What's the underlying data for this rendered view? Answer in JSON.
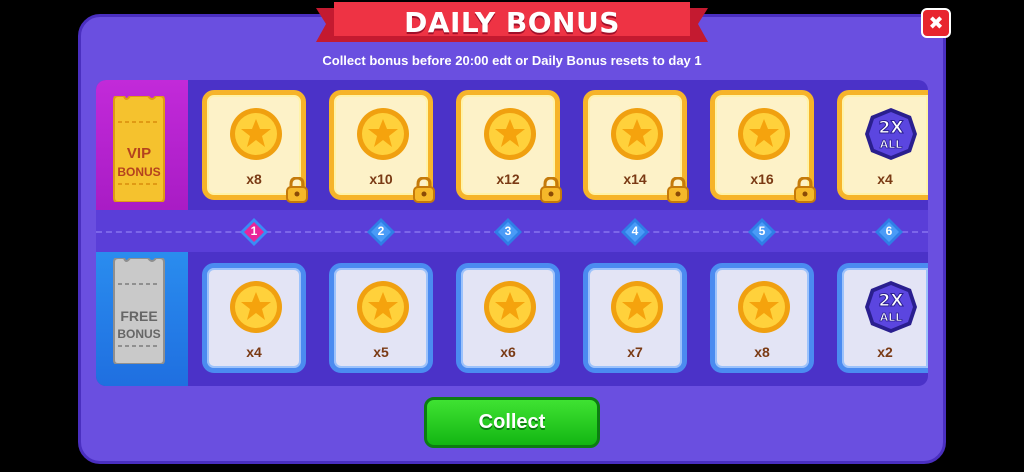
{
  "header": {
    "title": "DAILY BONUS",
    "subtitle": "Collect bonus before 20:00 edt or Daily Bonus resets to day 1",
    "close_symbol": "✖"
  },
  "vip_row": {
    "label_line1": "VIP",
    "label_line2": "BONUS",
    "rewards": [
      {
        "icon": "coin-icon",
        "qty": "x8",
        "locked": true
      },
      {
        "icon": "coin-icon",
        "qty": "x10",
        "locked": true
      },
      {
        "icon": "coin-icon",
        "qty": "x12",
        "locked": true
      },
      {
        "icon": "coin-icon",
        "qty": "x14",
        "locked": true
      },
      {
        "icon": "coin-icon",
        "qty": "x16",
        "locked": true
      },
      {
        "icon": "2x-all-badge-icon",
        "qty": "x4",
        "locked": true
      }
    ]
  },
  "days": [
    "1",
    "2",
    "3",
    "4",
    "5",
    "6"
  ],
  "current_day": "1",
  "free_row": {
    "label_line1": "FREE",
    "label_line2": "BONUS",
    "rewards": [
      {
        "icon": "coin-icon",
        "qty": "x4"
      },
      {
        "icon": "coin-icon",
        "qty": "x5"
      },
      {
        "icon": "coin-icon",
        "qty": "x6"
      },
      {
        "icon": "coin-icon",
        "qty": "x7"
      },
      {
        "icon": "coin-icon",
        "qty": "x8"
      },
      {
        "icon": "2x-all-badge-icon",
        "qty": "x2"
      }
    ]
  },
  "badge_text": {
    "line1": "2X",
    "line2": "ALL"
  },
  "collect_label": "Collect",
  "colors": {
    "panel": "#6a4fe0",
    "ribbon": "#ee3344",
    "vip_border": "#f6b42a",
    "free_border": "#4b8bf0",
    "collect": "#22c81e",
    "current_day": "#e8259a"
  }
}
